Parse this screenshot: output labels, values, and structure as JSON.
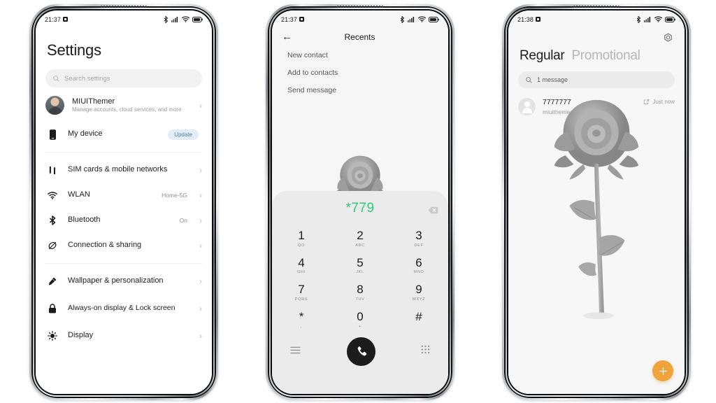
{
  "phones": {
    "settings": {
      "status": {
        "time": "21:37"
      },
      "title": "Settings",
      "search_placeholder": "Search settings",
      "account": {
        "name": "MIUIThemer",
        "subtitle": "Manage accounts, cloud services, and more"
      },
      "device": {
        "label": "My device",
        "badge": "Update"
      },
      "rows": [
        {
          "label": "SIM cards & mobile networks",
          "value": "",
          "icon": "sim-icon"
        },
        {
          "label": "WLAN",
          "value": "Home-5G",
          "icon": "wifi-icon"
        },
        {
          "label": "Bluetooth",
          "value": "On",
          "icon": "bluetooth-icon"
        },
        {
          "label": "Connection & sharing",
          "value": "",
          "icon": "link-icon"
        }
      ],
      "rows2": [
        {
          "label": "Wallpaper & personalization",
          "icon": "brush-icon"
        },
        {
          "label": "Always-on display & Lock screen",
          "icon": "lock-icon"
        },
        {
          "label": "Display",
          "icon": "brightness-icon"
        }
      ]
    },
    "dialer": {
      "status": {
        "time": "21:37"
      },
      "title": "Recents",
      "actions": [
        "New contact",
        "Add to contacts",
        "Send message"
      ],
      "number": "*779",
      "keys": [
        {
          "digit": "1",
          "letters": "QO"
        },
        {
          "digit": "2",
          "letters": "ABC"
        },
        {
          "digit": "3",
          "letters": "DEF"
        },
        {
          "digit": "4",
          "letters": "GHI"
        },
        {
          "digit": "5",
          "letters": "JKL"
        },
        {
          "digit": "6",
          "letters": "MNO"
        },
        {
          "digit": "7",
          "letters": "PQRS"
        },
        {
          "digit": "8",
          "letters": "TUV"
        },
        {
          "digit": "9",
          "letters": "WXYZ"
        },
        {
          "digit": "*",
          "letters": ","
        },
        {
          "digit": "0",
          "letters": "+"
        },
        {
          "digit": "#",
          "letters": ""
        }
      ],
      "accent": "#2ecc71"
    },
    "messages": {
      "status": {
        "time": "21:38"
      },
      "tab_active": "Regular",
      "tab_inactive": "Promotional",
      "search_value": "1 message",
      "message": {
        "sender": "7777777",
        "preview": "miuithemer.com",
        "time": "Just now"
      },
      "fab_label": "+",
      "fab_color": "#f0a33a"
    }
  }
}
